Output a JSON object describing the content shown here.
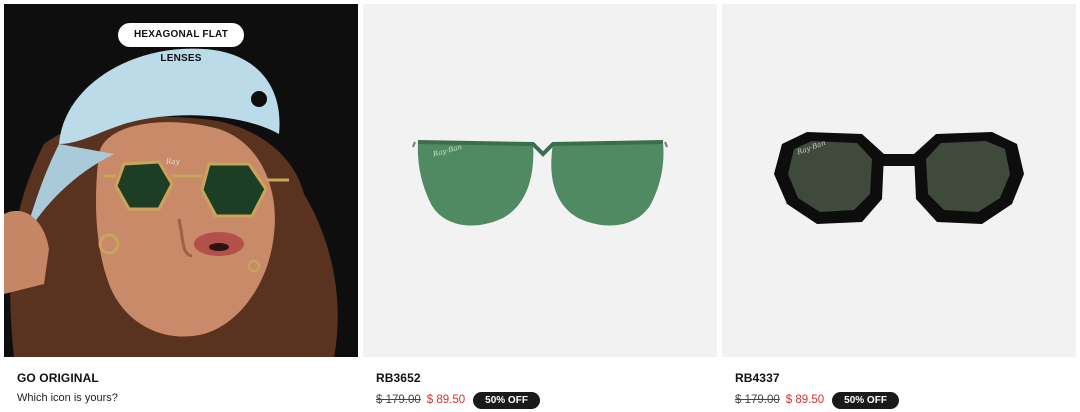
{
  "products": [
    {
      "title": "GO ORIGINAL",
      "subtitle": "Which icon is yours?",
      "image_badge": "HEXAGONAL FLAT LENSES"
    },
    {
      "title": "RB3652",
      "old_price": "$ 179.00",
      "new_price": "$ 89.50",
      "discount": "50% OFF"
    },
    {
      "title": "RB4337",
      "old_price": "$ 179.00",
      "new_price": "$ 89.50",
      "discount": "50% OFF"
    }
  ],
  "colors": {
    "sale_price": "#d6302b",
    "badge_bg": "#1a1a1a",
    "tile_bg": "#f2f2f2",
    "lens_green": "#4f8a63"
  }
}
